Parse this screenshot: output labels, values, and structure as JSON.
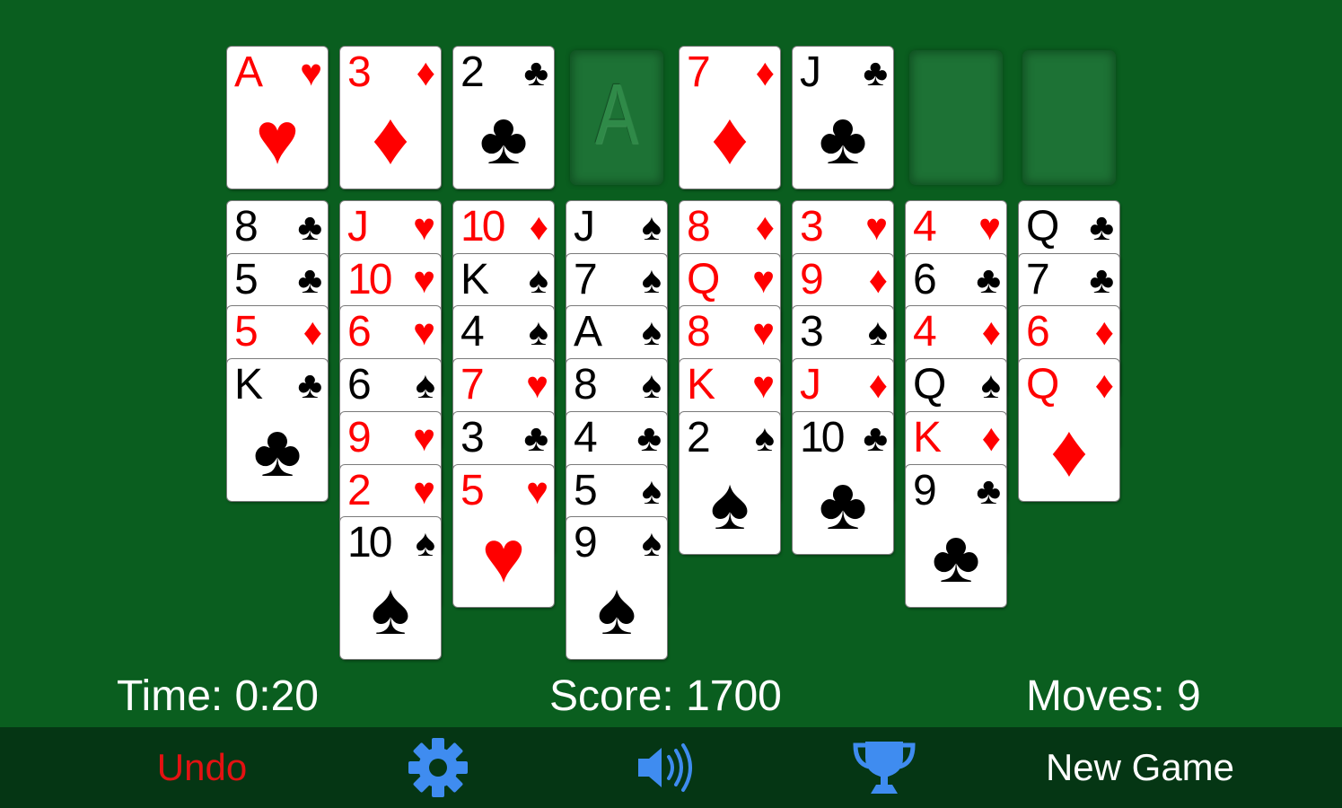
{
  "colors": {
    "felt": "#0a5e1f",
    "toolbar": "#053614",
    "red_suit": "#ff0000",
    "black_suit": "#000000",
    "undo": "#e31212",
    "icon_blue": "#3f8cf0",
    "text": "#ffffff"
  },
  "top_row": [
    {
      "type": "card",
      "rank": "A",
      "suit": "hearts"
    },
    {
      "type": "card",
      "rank": "3",
      "suit": "diamonds"
    },
    {
      "type": "card",
      "rank": "2",
      "suit": "clubs"
    },
    {
      "type": "empty",
      "label": "A"
    },
    {
      "type": "card",
      "rank": "7",
      "suit": "diamonds"
    },
    {
      "type": "card",
      "rank": "J",
      "suit": "clubs"
    },
    {
      "type": "empty",
      "label": ""
    },
    {
      "type": "empty",
      "label": ""
    }
  ],
  "tableau": [
    [
      {
        "rank": "8",
        "suit": "clubs"
      },
      {
        "rank": "5",
        "suit": "clubs"
      },
      {
        "rank": "5",
        "suit": "diamonds"
      },
      {
        "rank": "K",
        "suit": "clubs"
      }
    ],
    [
      {
        "rank": "J",
        "suit": "hearts"
      },
      {
        "rank": "10",
        "suit": "hearts"
      },
      {
        "rank": "6",
        "suit": "hearts"
      },
      {
        "rank": "6",
        "suit": "spades"
      },
      {
        "rank": "9",
        "suit": "hearts"
      },
      {
        "rank": "2",
        "suit": "hearts"
      },
      {
        "rank": "10",
        "suit": "spades"
      }
    ],
    [
      {
        "rank": "10",
        "suit": "diamonds"
      },
      {
        "rank": "K",
        "suit": "spades"
      },
      {
        "rank": "4",
        "suit": "spades"
      },
      {
        "rank": "7",
        "suit": "hearts"
      },
      {
        "rank": "3",
        "suit": "clubs"
      },
      {
        "rank": "5",
        "suit": "hearts"
      }
    ],
    [
      {
        "rank": "J",
        "suit": "spades"
      },
      {
        "rank": "7",
        "suit": "spades"
      },
      {
        "rank": "A",
        "suit": "spades"
      },
      {
        "rank": "8",
        "suit": "spades"
      },
      {
        "rank": "4",
        "suit": "clubs"
      },
      {
        "rank": "5",
        "suit": "spades"
      },
      {
        "rank": "9",
        "suit": "spades"
      }
    ],
    [
      {
        "rank": "8",
        "suit": "diamonds"
      },
      {
        "rank": "Q",
        "suit": "hearts"
      },
      {
        "rank": "8",
        "suit": "hearts"
      },
      {
        "rank": "K",
        "suit": "hearts"
      },
      {
        "rank": "2",
        "suit": "spades"
      }
    ],
    [
      {
        "rank": "3",
        "suit": "hearts"
      },
      {
        "rank": "9",
        "suit": "diamonds"
      },
      {
        "rank": "3",
        "suit": "spades"
      },
      {
        "rank": "J",
        "suit": "diamonds"
      },
      {
        "rank": "10",
        "suit": "clubs"
      }
    ],
    [
      {
        "rank": "4",
        "suit": "hearts"
      },
      {
        "rank": "6",
        "suit": "clubs"
      },
      {
        "rank": "4",
        "suit": "diamonds"
      },
      {
        "rank": "Q",
        "suit": "spades"
      },
      {
        "rank": "K",
        "suit": "diamonds"
      },
      {
        "rank": "9",
        "suit": "clubs"
      }
    ],
    [
      {
        "rank": "Q",
        "suit": "clubs"
      },
      {
        "rank": "7",
        "suit": "clubs"
      },
      {
        "rank": "6",
        "suit": "diamonds"
      },
      {
        "rank": "Q",
        "suit": "diamonds"
      }
    ]
  ],
  "stats": {
    "time": "Time: 0:20",
    "score": "Score: 1700",
    "moves": "Moves: 9"
  },
  "toolbar": {
    "undo_label": "Undo",
    "settings_icon": "gear-icon",
    "sound_icon": "speaker-icon",
    "trophy_icon": "trophy-icon",
    "new_game_label": "New Game"
  }
}
